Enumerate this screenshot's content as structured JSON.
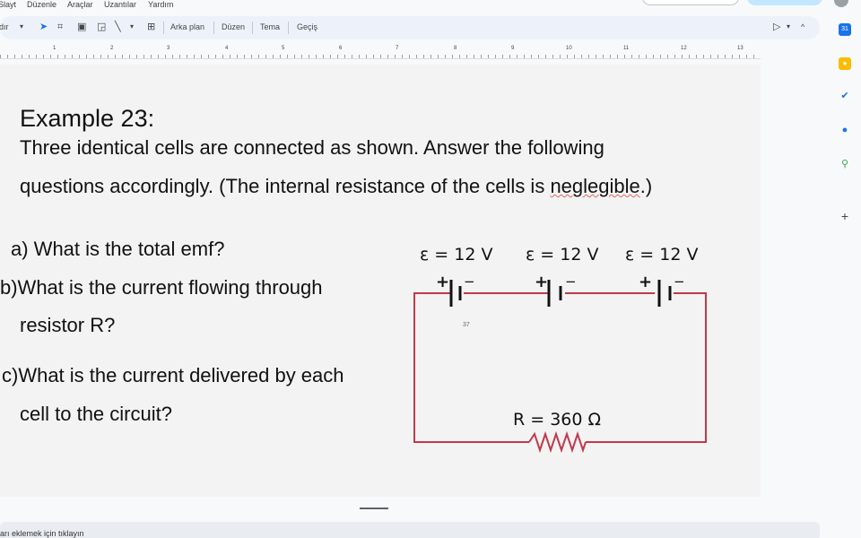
{
  "menu": {
    "items": [
      "Slayt",
      "Düzenle",
      "Araçlar",
      "Uzantılar",
      "Yardım"
    ]
  },
  "toolbar": {
    "left_partial": "dır",
    "background_label": "Arka plan",
    "layout_label": "Düzen",
    "theme_label": "Tema",
    "transition_label": "Geçiş"
  },
  "ruler": {
    "numbers": [
      "1",
      "2",
      "3",
      "4",
      "5",
      "6",
      "7",
      "8",
      "9",
      "10",
      "11",
      "12",
      "13"
    ]
  },
  "slide": {
    "title": "Example 23:",
    "intro_line1": "Three identical cells are connected as shown. Answer the following",
    "intro_line2_before": "questions accordingly. (The internal resistance of the cells is ",
    "intro_line2_misspelled": "neglegible",
    "intro_line2_after": ".)",
    "q_a": "a)  What is the total emf?",
    "q_b1": "b)What is the current flowing through",
    "q_b2": "resistor R?",
    "q_c1": "c)What is the current delivered by each",
    "q_c2": "cell to the circuit?",
    "slide_number": "37"
  },
  "circuit": {
    "cells": [
      {
        "emf_label": "ε = 12 V",
        "plus": "+",
        "minus": "−"
      },
      {
        "emf_label": "ε = 12 V",
        "plus": "+",
        "minus": "−"
      },
      {
        "emf_label": "ε = 12 V",
        "plus": "+",
        "minus": "−"
      }
    ],
    "resistor_label": "R = 360 Ω",
    "wire_color": "#c0394b"
  },
  "notes": {
    "placeholder": "arı eklemek için tıklayın"
  },
  "colors": {
    "toolbar_bg": "#edf2fa",
    "accent_blue": "#1a73e8"
  }
}
